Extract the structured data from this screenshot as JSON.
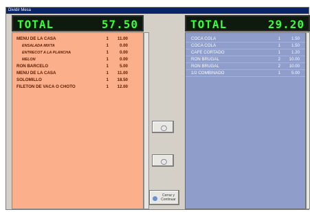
{
  "window": {
    "title": "Dividir Mesa"
  },
  "left_display": {
    "label": "TOTAL",
    "value": "57.50"
  },
  "right_display": {
    "label": "TOTAL",
    "value": "29.20"
  },
  "left_items": [
    {
      "name": "MENU DE LA CASA",
      "qty": "1",
      "price": "11.00",
      "sub": false
    },
    {
      "name": "ENSALADA MIXTA",
      "qty": "1",
      "price": "0.00",
      "sub": true
    },
    {
      "name": "ENTRECOT A LA PLANCHA",
      "qty": "1",
      "price": "0.00",
      "sub": true
    },
    {
      "name": "MELON",
      "qty": "1",
      "price": "0.00",
      "sub": true
    },
    {
      "name": "RON BARCELO",
      "qty": "1",
      "price": "5.00",
      "sub": false
    },
    {
      "name": "MENU DE LA CASA",
      "qty": "1",
      "price": "11.00",
      "sub": false
    },
    {
      "name": "SOLOMILLO",
      "qty": "1",
      "price": "18.50",
      "sub": false
    },
    {
      "name": "FILETON DE VACA O CHOTO",
      "qty": "1",
      "price": "12.00",
      "sub": false
    }
  ],
  "right_items": [
    {
      "name": "COCA COLA",
      "qty": "1",
      "price": "1.50"
    },
    {
      "name": "COCA COLA",
      "qty": "1",
      "price": "1.50"
    },
    {
      "name": "CAFE CORTADO",
      "qty": "1",
      "price": "1.20"
    },
    {
      "name": "RON BRUGAL",
      "qty": "2",
      "price": "10.00"
    },
    {
      "name": "RON BRUGAL",
      "qty": "2",
      "price": "10.00"
    },
    {
      "name": "1/2 COMBINADO",
      "qty": "1",
      "price": "5.00"
    }
  ],
  "buttons": {
    "move_right_icon": "arrow-right",
    "move_left_icon": "arrow-left",
    "close_label": "Cerrar y Continuar",
    "close_icon": "close"
  },
  "colors": {
    "left_panel": "#fbaf8a",
    "right_panel": "#8e9dc9",
    "lcd_text": "#39ff3a",
    "lcd_bg": "#0d1a0d"
  }
}
